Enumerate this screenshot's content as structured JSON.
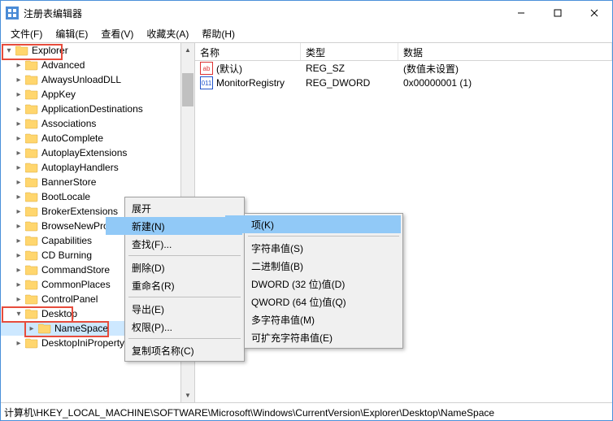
{
  "window": {
    "title": "注册表编辑器"
  },
  "menubar": {
    "file": "文件(F)",
    "edit": "编辑(E)",
    "view": "查看(V)",
    "favorites": "收藏夹(A)",
    "help": "帮助(H)"
  },
  "tree": {
    "root": "Explorer",
    "items": [
      "Advanced",
      "AlwaysUnloadDLL",
      "AppKey",
      "ApplicationDestinations",
      "Associations",
      "AutoComplete",
      "AutoplayExtensions",
      "AutoplayHandlers",
      "BannerStore",
      "BootLocale",
      "BrokerExtensions",
      "BrowseNewProcess",
      "Capabilities",
      "CD Burning",
      "CommandStore",
      "CommonPlaces",
      "ControlPanel"
    ],
    "desktop": "Desktop",
    "namespace": "NameSpace",
    "last": "DesktopIniPropertyMap"
  },
  "list": {
    "columns": {
      "name": "名称",
      "type": "类型",
      "data": "数据"
    },
    "rows": [
      {
        "icon": "ab",
        "iconColor": "#d33",
        "name": "(默认)",
        "type": "REG_SZ",
        "data": "(数值未设置)"
      },
      {
        "icon": "011",
        "iconColor": "#2255cc",
        "name": "MonitorRegistry",
        "type": "REG_DWORD",
        "data": "0x00000001 (1)"
      }
    ]
  },
  "contextMenu1": {
    "expand": "展开",
    "new": "新建(N)",
    "find": "查找(F)...",
    "delete": "删除(D)",
    "rename": "重命名(R)",
    "export": "导出(E)",
    "permissions": "权限(P)...",
    "copyKeyName": "复制项名称(C)"
  },
  "contextMenu2": {
    "key": "项(K)",
    "string": "字符串值(S)",
    "binary": "二进制值(B)",
    "dword": "DWORD (32 位)值(D)",
    "qword": "QWORD (64 位)值(Q)",
    "multiString": "多字符串值(M)",
    "expandString": "可扩充字符串值(E)"
  },
  "statusbar": {
    "path": "计算机\\HKEY_LOCAL_MACHINE\\SOFTWARE\\Microsoft\\Windows\\CurrentVersion\\Explorer\\Desktop\\NameSpace"
  }
}
